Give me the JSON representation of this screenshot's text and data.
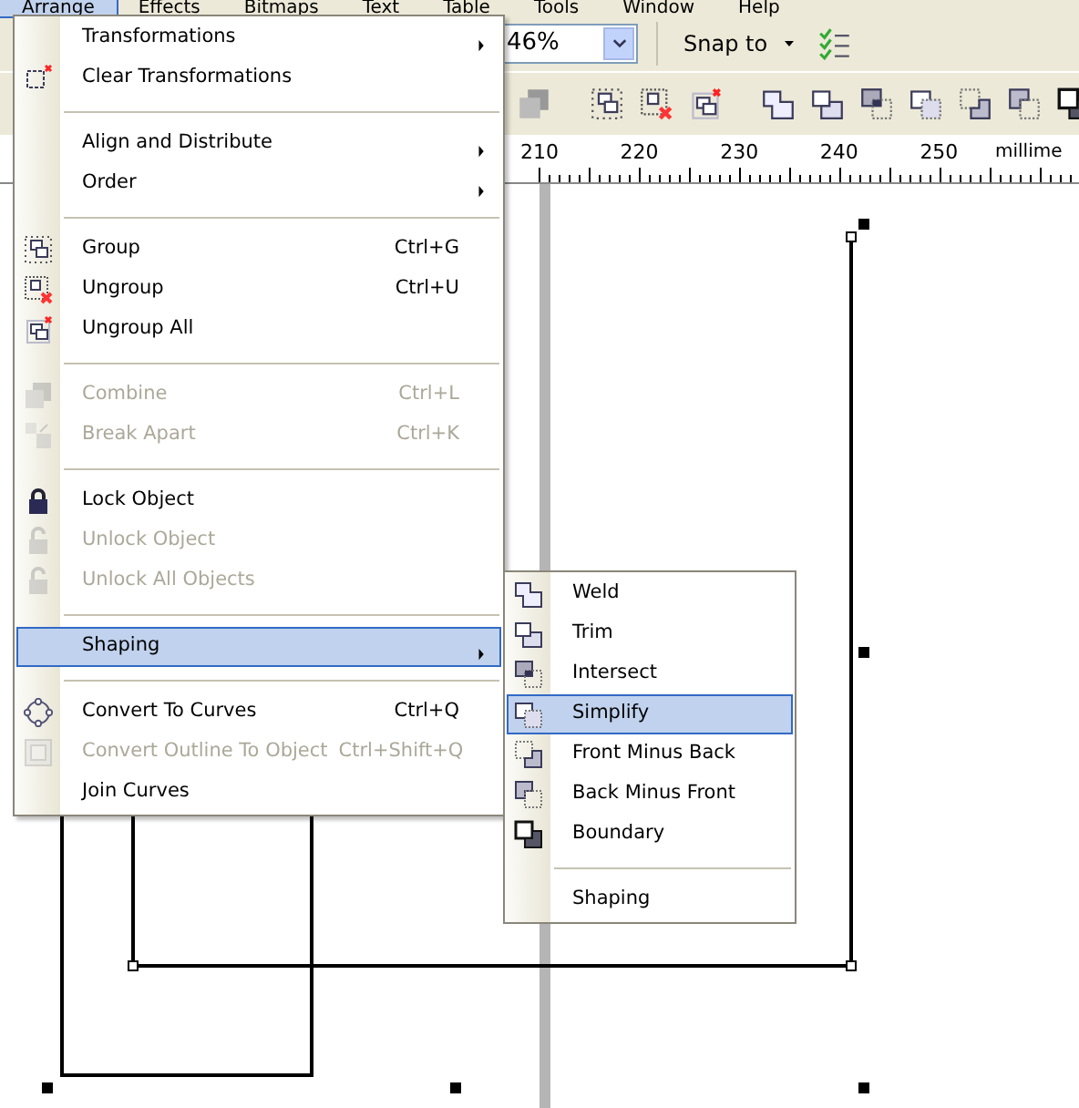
{
  "menu_bar": [
    {
      "label": "Arrange",
      "selected": true
    },
    {
      "label": "Effects",
      "selected": false
    },
    {
      "label": "Bitmaps",
      "selected": false
    },
    {
      "label": "Text",
      "selected": false
    },
    {
      "label": "Table",
      "selected": false
    },
    {
      "label": "Tools",
      "selected": false
    },
    {
      "label": "Window",
      "selected": false
    },
    {
      "label": "Help",
      "selected": false
    }
  ],
  "toolbar": {
    "zoom": "46%",
    "snap": "Snap to"
  },
  "ruler": {
    "ticks": [
      "210",
      "220",
      "230",
      "240",
      "250"
    ],
    "unit": "millime"
  },
  "menu": {
    "items": [
      {
        "kind": "item",
        "label": "Transformations",
        "submenu": true,
        "disabled": false,
        "selected": false
      },
      {
        "kind": "item",
        "label": "Clear Transformations",
        "submenu": false,
        "disabled": false,
        "selected": false
      },
      {
        "kind": "separator"
      },
      {
        "kind": "item",
        "label": "Align and Distribute",
        "submenu": true,
        "disabled": false,
        "selected": false
      },
      {
        "kind": "item",
        "label": "Order",
        "submenu": true,
        "disabled": false,
        "selected": false
      },
      {
        "kind": "separator"
      },
      {
        "kind": "item",
        "label": "Group",
        "shortcut": "Ctrl+G",
        "submenu": false,
        "disabled": false,
        "selected": false
      },
      {
        "kind": "item",
        "label": "Ungroup",
        "shortcut": "Ctrl+U",
        "submenu": false,
        "disabled": false,
        "selected": false
      },
      {
        "kind": "item",
        "label": "Ungroup All",
        "submenu": false,
        "disabled": false,
        "selected": false
      },
      {
        "kind": "separator"
      },
      {
        "kind": "item",
        "label": "Combine",
        "shortcut": "Ctrl+L",
        "submenu": false,
        "disabled": true,
        "selected": false
      },
      {
        "kind": "item",
        "label": "Break  Apart",
        "shortcut": "Ctrl+K",
        "submenu": false,
        "disabled": true,
        "selected": false
      },
      {
        "kind": "separator"
      },
      {
        "kind": "item",
        "label": "Lock Object",
        "submenu": false,
        "disabled": false,
        "selected": false
      },
      {
        "kind": "item",
        "label": "Unlock Object",
        "submenu": false,
        "disabled": true,
        "selected": false
      },
      {
        "kind": "item",
        "label": "Unlock All Objects",
        "submenu": false,
        "disabled": true,
        "selected": false
      },
      {
        "kind": "separator"
      },
      {
        "kind": "item",
        "label": "Shaping",
        "submenu": true,
        "disabled": false,
        "selected": true
      },
      {
        "kind": "separator"
      },
      {
        "kind": "item",
        "label": "Convert To Curves",
        "shortcut": "Ctrl+Q",
        "submenu": false,
        "disabled": false,
        "selected": false
      },
      {
        "kind": "item",
        "label": "Convert Outline To Object",
        "shortcut": "Ctrl+Shift+Q",
        "submenu": false,
        "disabled": true,
        "selected": false
      },
      {
        "kind": "item",
        "label": "Join Curves",
        "submenu": false,
        "disabled": false,
        "selected": false
      }
    ]
  },
  "submenu": {
    "items": [
      {
        "kind": "item",
        "label": "Weld",
        "selected": false
      },
      {
        "kind": "item",
        "label": "Trim",
        "selected": false
      },
      {
        "kind": "item",
        "label": "Intersect",
        "selected": false
      },
      {
        "kind": "item",
        "label": "Simplify",
        "selected": true
      },
      {
        "kind": "item",
        "label": "Front Minus Back",
        "selected": false
      },
      {
        "kind": "item",
        "label": "Back Minus Front",
        "selected": false
      },
      {
        "kind": "item",
        "label": "Boundary",
        "selected": false
      },
      {
        "kind": "separator"
      },
      {
        "kind": "item",
        "label": "Shaping",
        "selected": false
      }
    ]
  }
}
